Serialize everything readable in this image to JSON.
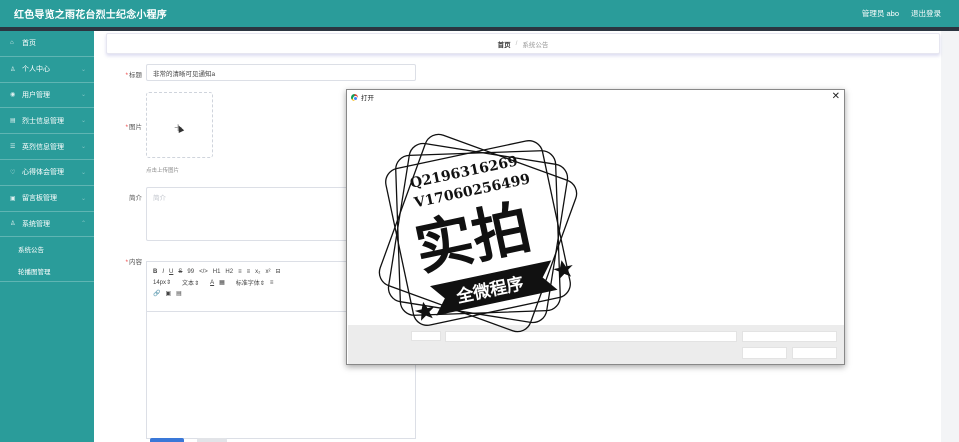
{
  "header": {
    "app_title": "红色导览之雨花台烈士纪念小程序",
    "admin_label": "管理员 abo",
    "logout_label": "退出登录"
  },
  "sidebar": {
    "items": [
      {
        "label": "首页",
        "icon": "home-icon"
      },
      {
        "label": "个人中心",
        "icon": "user-icon"
      },
      {
        "label": "用户管理",
        "icon": "users-icon"
      },
      {
        "label": "烈士信息管理",
        "icon": "list-icon"
      },
      {
        "label": "英烈信息管理",
        "icon": "menu-icon"
      },
      {
        "label": "心得体会管理",
        "icon": "heart-icon"
      },
      {
        "label": "留言板管理",
        "icon": "message-icon"
      },
      {
        "label": "系统管理",
        "icon": "gear-icon"
      }
    ],
    "sub_items": [
      {
        "label": "系统公告"
      },
      {
        "label": "轮播图管理"
      }
    ]
  },
  "breadcrumb": {
    "home": "首页",
    "separator": "/",
    "current": "系统公告"
  },
  "form": {
    "title_label": "标题",
    "title_value": "非常的清晰可见通知a",
    "image_label": "图片",
    "upload_hint": "点击上传图片",
    "intro_label": "简介",
    "intro_placeholder": "简介",
    "content_label": "内容"
  },
  "editor": {
    "toolbar_row1": [
      "B",
      "I",
      "U",
      "S",
      "99",
      "</>",
      "H1",
      "H2",
      "≡",
      "≡",
      "x₂",
      "x²",
      "⊟"
    ],
    "font_size": "14px",
    "text_type": "文本",
    "text_color": "A",
    "font_family": "标准字体",
    "toolbar_row3": [
      "🔗",
      "▣",
      "▤"
    ]
  },
  "dialog": {
    "title": "打开",
    "close_label": "✕"
  },
  "watermark": {
    "line1": "Q2196316269",
    "line2": "V17060256499",
    "big_text": "实拍",
    "banner_text": "全微程序"
  },
  "colors": {
    "brand": "#2a9c9a",
    "header_strip": "#2b3540",
    "required_mark": "#e44444"
  }
}
